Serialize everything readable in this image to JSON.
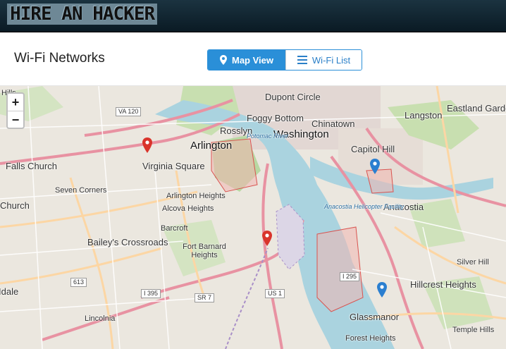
{
  "app": {
    "logo": "HIRE AN HACKER"
  },
  "header": {
    "title": "Wi-Fi Networks",
    "map_view_label": "Map View",
    "wifi_list_label": "Wi-Fi List",
    "active_view": "Map View"
  },
  "map": {
    "zoom_in": "+",
    "zoom_out": "−",
    "labels": {
      "hills": "Hills",
      "dupont": "Dupont Circle",
      "foggy": "Foggy Bottom",
      "chinatown": "Chinatown",
      "langston": "Langston",
      "eastland": "Eastland Gardens",
      "va120": "VA 120",
      "rosslyn": "Rosslyn",
      "washington": "Washington",
      "potomac": "Potomac River",
      "arlington": "Arlington",
      "capitol": "Capitol Hill",
      "falls": "Falls Church",
      "virginia_sq": "Virginia Square",
      "seven": "Seven Corners",
      "arl_heights": "Arlington Heights",
      "alcova": "Alcova Heights",
      "church": "Church",
      "anacostia": "Anacostia",
      "anacostia_heli": "Anacostia Helicopter Facility",
      "barcroft": "Barcroft",
      "bailey": "Bailey's Crossroads",
      "fort_barnard": "Fort Barnard Heights",
      "silver_hill": "Silver Hill",
      "hillcrest": "Hillcrest Heights",
      "dale": "Idale",
      "lincolnia": "Lincolnia",
      "glassmanor": "Glassmanor",
      "temple": "Temple Hills",
      "forest": "Forest Heights",
      "i395": "I 395",
      "sr7": "SR 7",
      "us1": "US 1",
      "i295": "I 295",
      "r613": "613"
    },
    "pins": [
      {
        "color": "#d9342b"
      },
      {
        "color": "#d9342b"
      },
      {
        "color": "#2b7fd0"
      },
      {
        "color": "#2b7fd0"
      }
    ]
  }
}
